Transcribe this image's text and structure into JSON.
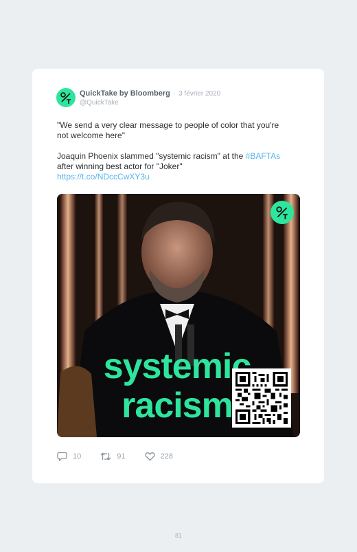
{
  "tweet": {
    "author_name": "QuickTake by Bloomberg",
    "separator": "·",
    "date": "3 février 2020",
    "handle": "@QuickTake",
    "quote": "\"We send a very clear message to people of color that you're not welcome here\"",
    "body_before": "Joaquin Phoenix slammed \"systemic racism\" at the ",
    "hashtag": "#BAFTAs",
    "body_after": " after winning best actor for \"Joker\"",
    "link": "https://t.co/NDccCwXY3u"
  },
  "media": {
    "caption_line1": "systemic",
    "caption_line2": "racism",
    "accent_color": "#2ee59d",
    "logo_icon": "quicktake-logo-icon",
    "qr_icon": "qr-code-icon"
  },
  "actions": {
    "reply_icon": "reply-icon",
    "reply_count": "10",
    "retweet_icon": "retweet-icon",
    "retweet_count": "91",
    "like_icon": "heart-icon",
    "like_count": "228"
  },
  "page_number": "81"
}
